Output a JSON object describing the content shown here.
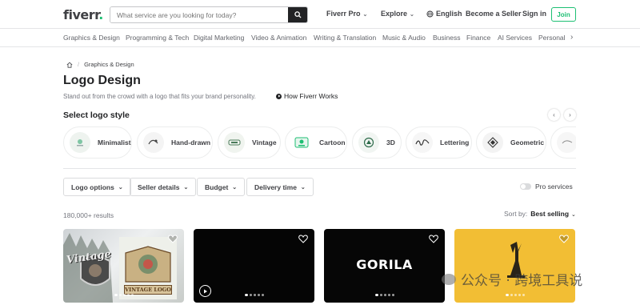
{
  "header": {
    "logo": "fiverr",
    "logo_dot": ".",
    "search_placeholder": "What service are you looking for today?",
    "nav": {
      "fiverr_pro": "Fiverr Pro",
      "explore": "Explore",
      "language": "English",
      "become_seller": "Become a Seller",
      "sign_in": "Sign in",
      "join": "Join"
    }
  },
  "categories": [
    "Graphics & Design",
    "Programming & Tech",
    "Digital Marketing",
    "Video & Animation",
    "Writing & Translation",
    "Music & Audio",
    "Business",
    "Finance",
    "AI Services",
    "Personal G"
  ],
  "breadcrumb": {
    "current": "Graphics & Design",
    "separator": "/"
  },
  "page": {
    "title": "Logo Design",
    "subtitle": "Stand out from the crowd with a logo that fits your brand personality.",
    "how_it_works": "How Fiverr Works"
  },
  "logo_styles": {
    "title": "Select logo style",
    "items": [
      "Minimalist",
      "Hand-drawn",
      "Vintage",
      "Cartoon",
      "3D",
      "Lettering",
      "Geometric"
    ]
  },
  "filters": {
    "items": [
      "Logo options",
      "Seller details",
      "Budget",
      "Delivery time"
    ],
    "pro_services": "Pro services"
  },
  "results": {
    "count": "180,000+ results",
    "sort_label": "Sort by:",
    "sort_value": "Best selling"
  },
  "gigs": {
    "card1": {
      "title_word": "Vintage",
      "badge": "VINTAGE LOGO"
    },
    "card3": {
      "brand": "GORILA"
    }
  },
  "watermark": "公众号 · 跨境工具说",
  "colors": {
    "brand_green": "#1dbf73",
    "text_dark": "#222325",
    "text_muted": "#74767e"
  }
}
